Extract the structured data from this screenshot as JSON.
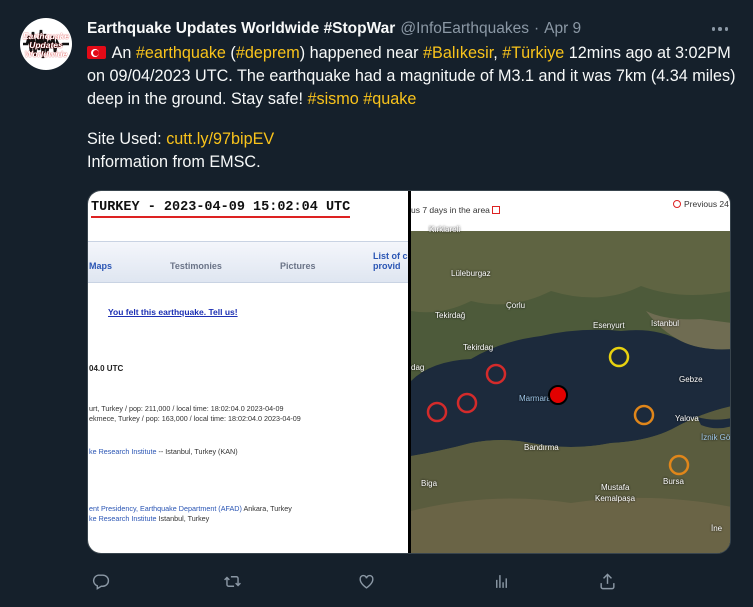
{
  "tweet": {
    "author_name": "Earthquake Updates Worldwide #StopWar",
    "handle": "@InfoEarthquakes",
    "separator": "·",
    "date": "Apr 9",
    "avatar_lines": [
      "Earthquake",
      "Updates",
      "Worldwide"
    ],
    "body": {
      "t1": "An ",
      "h1": "#earthquake",
      "t2": " (",
      "h2": "#deprem",
      "t3": ") happened near ",
      "h3": "#Balıkesir",
      "t4": ", ",
      "h4": "#Türkiye",
      "t5": " 12mins ago at 3:02PM on 09/04/2023 UTC. The earthquake had a magnitude of M3.1 and it was 7km (4.34 miles) deep in the ground. Stay safe! ",
      "h5": "#sismo",
      "t6": " ",
      "h6": "#quake",
      "site_label": "Site Used: ",
      "site_link": "cutt.ly/97bipEV",
      "info": "Information from EMSC."
    }
  },
  "media_left": {
    "title": "TURKEY - 2023-04-09 15:02:04 UTC",
    "tabs": [
      "Maps",
      "Testimonies",
      "Pictures"
    ],
    "tab_list_line1": "List of c",
    "tab_list_line2": "provid",
    "felt_link": "You felt this earthquake. Tell us!",
    "utc_line": "04.0 UTC",
    "near_line1": "urt, Turkey / pop: 211,000 / local time: 18:02:04.0 2023-04-09",
    "near_line2": "ekmece, Turkey / pop: 163,000 / local time: 18:02:04.0 2023-04-09",
    "kan_link": "ke Research Institute",
    "kan_rest": " -- Istanbul, Turkey (KAN)",
    "afad_link1": "ent Presidency, Earthquake Department (AFAD)",
    "afad_rest1": " Ankara, Turkey",
    "afad_link2": "ke Research Institute",
    "afad_rest2": " Istanbul, Turkey"
  },
  "media_right": {
    "prev7": "us 7 days in the area",
    "prev24": "Previous 24",
    "places": {
      "kirklareli": "Kırklareli",
      "luleburgaz": "Lüleburgaz",
      "corlu": "Çorlu",
      "tekirdag": "Tekirdağ",
      "tekirdag2": "Tekirdag",
      "esenyurt": "Esenyurt",
      "istanbul": "Istanbul",
      "gebze": "Gebze",
      "dag": "dag",
      "marmara": "Marmara",
      "yalova": "Yalova",
      "iznik": "İznik Gö",
      "bandirma": "Bandırma",
      "bursa": "Bursa",
      "mustafa": "Mustafa",
      "kemalpasa": "Kemalpaşa",
      "biga": "Biga",
      "ine": "İne"
    },
    "colors": {
      "red": "#d42b2b",
      "yellow": "#e8d20f",
      "orange": "#e0861a",
      "main": "#e30000"
    }
  },
  "actions": [
    "reply-icon",
    "retweet-icon",
    "like-icon",
    "views-icon",
    "share-icon"
  ]
}
